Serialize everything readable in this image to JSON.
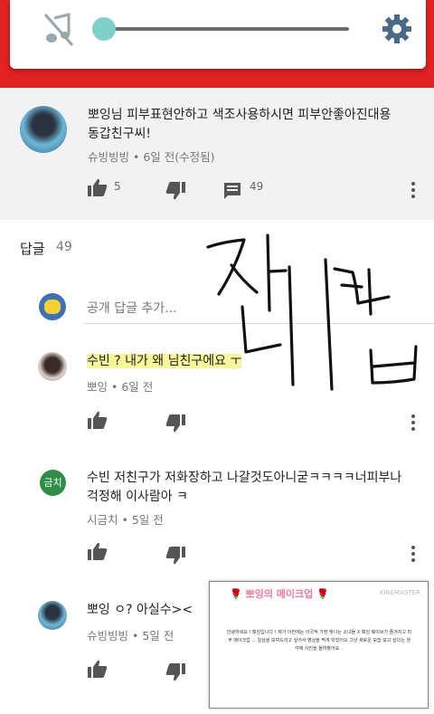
{
  "main_comment": {
    "text_line1": "뽀잉님 피부표현안하고 색조사용하시면 피부안좋아진대용",
    "text_line2": "동갑친구씨!",
    "author": "슈빙빙빙",
    "time": "6일 전(수정됨)",
    "likes": "5",
    "replies": "49"
  },
  "replies_header": {
    "label": "답글",
    "count": "49"
  },
  "add_reply_placeholder": "공개 답글 추가...",
  "replies": [
    {
      "text": "수빈 ? 내가 왜 님친구에요 ㅜ",
      "author": "뽀잉",
      "time": "6일 전"
    },
    {
      "text_line1": "수빈 저친구가 저화장하고 나갈것도아니굳ㅋㅋㅋㅋ너피부나",
      "text_line2": "걱정해 이사람아 ㅋ",
      "author": "시금치",
      "time": "5일 전",
      "avatar_label": "금치"
    },
    {
      "text": "뽀잉 ㅇ? 아실수><",
      "author": "슈빙빙빙",
      "time": "5일 전"
    }
  ],
  "handwriting": "잘 띠꺼ㅂ",
  "thumbnail": {
    "title": "🌹 뽀잉의 메이크업 🌹",
    "watermark": "KINEMASTER",
    "body": "안녕하세요 ! 뽀잉입니다 ! 제가 이번에는 이국적 가장 빛나는 소녀들 X 뽀잉 웨이브가 즐겨지고 피부 메이크업 ... 일상을 보여드리고 싶어서 영상을 찍게 되었어요 그냥 새로운 모습 보고 싶다는 생각에 사진을 올려봤어요 .."
  },
  "colors": {
    "red": "#e32222",
    "thumb_teal": "#7ed0c9",
    "highlight": "#f6f79a",
    "geumchi": "#2e8d46"
  }
}
